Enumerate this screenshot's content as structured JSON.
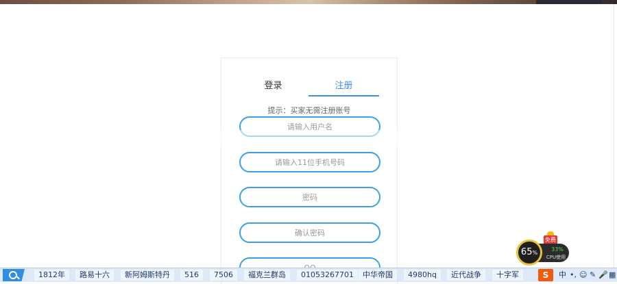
{
  "tabs": {
    "login": "登录",
    "register": "注册"
  },
  "hint": "提示：买家无需注册账号",
  "fields": [
    {
      "placeholder": "请输入用户名"
    },
    {
      "placeholder": "请输入11位手机号码"
    },
    {
      "placeholder": "密码"
    },
    {
      "placeholder": "确认密码"
    },
    {
      "placeholder": "QQ"
    }
  ],
  "cpu_widget": {
    "gift_label": "免费",
    "ring_value": "65",
    "ring_unit": "%",
    "usage_percent": "33%",
    "usage_label": "CPU使用"
  },
  "taskbar": {
    "hot_words": [
      "1812年",
      "路易十六",
      "新阿姆斯特丹",
      "516",
      "7506",
      "福克兰群岛",
      "01053267701",
      "中华帝国",
      "4980hq",
      "近代战争",
      "十字军"
    ],
    "tray": {
      "ime_logo": "S",
      "lang": "中",
      "punct": "•,",
      "emoji": "☺",
      "pen": "✎",
      "mic": "🎤",
      "grid": "▦",
      "settings": "⚙"
    }
  }
}
